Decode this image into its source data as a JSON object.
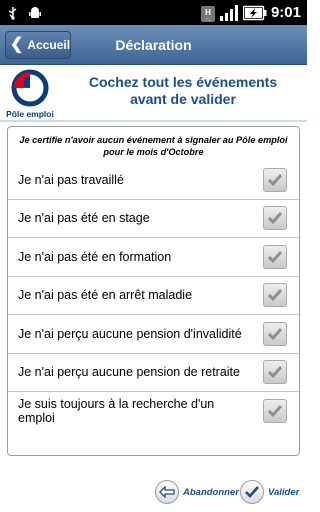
{
  "status_bar": {
    "time": "9:01",
    "icons": [
      "usb-icon",
      "android-debug-icon",
      "hspa-icon",
      "signal-icon",
      "battery-charging-icon"
    ]
  },
  "header": {
    "back_label": "Accueil",
    "title": "Déclaration"
  },
  "banner": {
    "logo_text": "Pôle emploi",
    "line1": "Cochez tout les événements",
    "line2": "avant de valider"
  },
  "form": {
    "intro": "Je certifie n'avoir aucun événement à signaler au Pôle emploi pour le mois d'Octobre",
    "items": [
      {
        "label": "Je n'ai pas travaillé",
        "checked": true
      },
      {
        "label": "Je n'ai pas été en stage",
        "checked": true
      },
      {
        "label": "Je n'ai pas été en formation",
        "checked": true
      },
      {
        "label": "Je n'ai pas été en arrêt maladie",
        "checked": true
      },
      {
        "label": "Je n'ai perçu aucune pension d'invalidité",
        "checked": true
      },
      {
        "label": "Je n'ai perçu aucune pension de retraite",
        "checked": true
      },
      {
        "label": "Je suis toujours à la recherche d'un emploi",
        "checked": true
      }
    ]
  },
  "actions": {
    "abandon_label": "Abandonner",
    "validate_label": "Valider"
  },
  "colors": {
    "title_bar": "#4a6f9c",
    "brand_blue": "#1a4f8c",
    "brand_red": "#e3001b"
  }
}
